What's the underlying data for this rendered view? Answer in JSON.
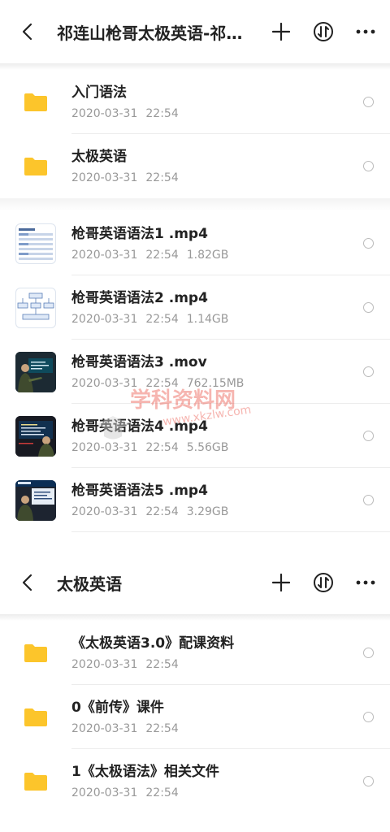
{
  "screen1": {
    "title": "祁连山枪哥太极英语-祁连山",
    "folders": [
      {
        "name": "入门语法",
        "date": "2020-03-31",
        "time": "22:54"
      },
      {
        "name": "太极英语",
        "date": "2020-03-31",
        "time": "22:54"
      }
    ],
    "files": [
      {
        "name": "枪哥英语语法1 .mp4",
        "date": "2020-03-31",
        "time": "22:54",
        "size": "1.82GB",
        "thumb": "spreadsheet-thumbnail"
      },
      {
        "name": "枪哥英语语法2 .mp4",
        "date": "2020-03-31",
        "time": "22:54",
        "size": "1.14GB",
        "thumb": "diagram-thumbnail"
      },
      {
        "name": "枪哥英语语法3 .mov",
        "date": "2020-03-31",
        "time": "22:54",
        "size": "762.15MB",
        "thumb": "video-thumbnail"
      },
      {
        "name": "枪哥英语语法4 .mp4",
        "date": "2020-03-31",
        "time": "22:54",
        "size": "5.56GB",
        "thumb": "video-thumbnail"
      },
      {
        "name": "枪哥英语语法5 .mp4",
        "date": "2020-03-31",
        "time": "22:54",
        "size": "3.29GB",
        "thumb": "video-thumbnail"
      }
    ]
  },
  "screen2": {
    "title": "太极英语",
    "folders": [
      {
        "name": "《太极英语3.0》配课资料",
        "date": "2020-03-31",
        "time": "22:54"
      },
      {
        "name": "0《前传》课件",
        "date": "2020-03-31",
        "time": "22:54"
      },
      {
        "name": "1《太极语法》相关文件",
        "date": "2020-03-31",
        "time": "22:54"
      }
    ]
  },
  "watermark": {
    "text": "学科资料网",
    "url": "www.xkzlw.com"
  },
  "icons": {
    "back": "chevron-left-icon",
    "add": "plus-icon",
    "sort": "sort-arrows-icon",
    "more": "more-dots-icon",
    "folder": "folder-icon"
  },
  "colors": {
    "folder": "#fcc52b",
    "text": "#222222",
    "meta": "#999999",
    "watermark": "#eb5a50"
  }
}
